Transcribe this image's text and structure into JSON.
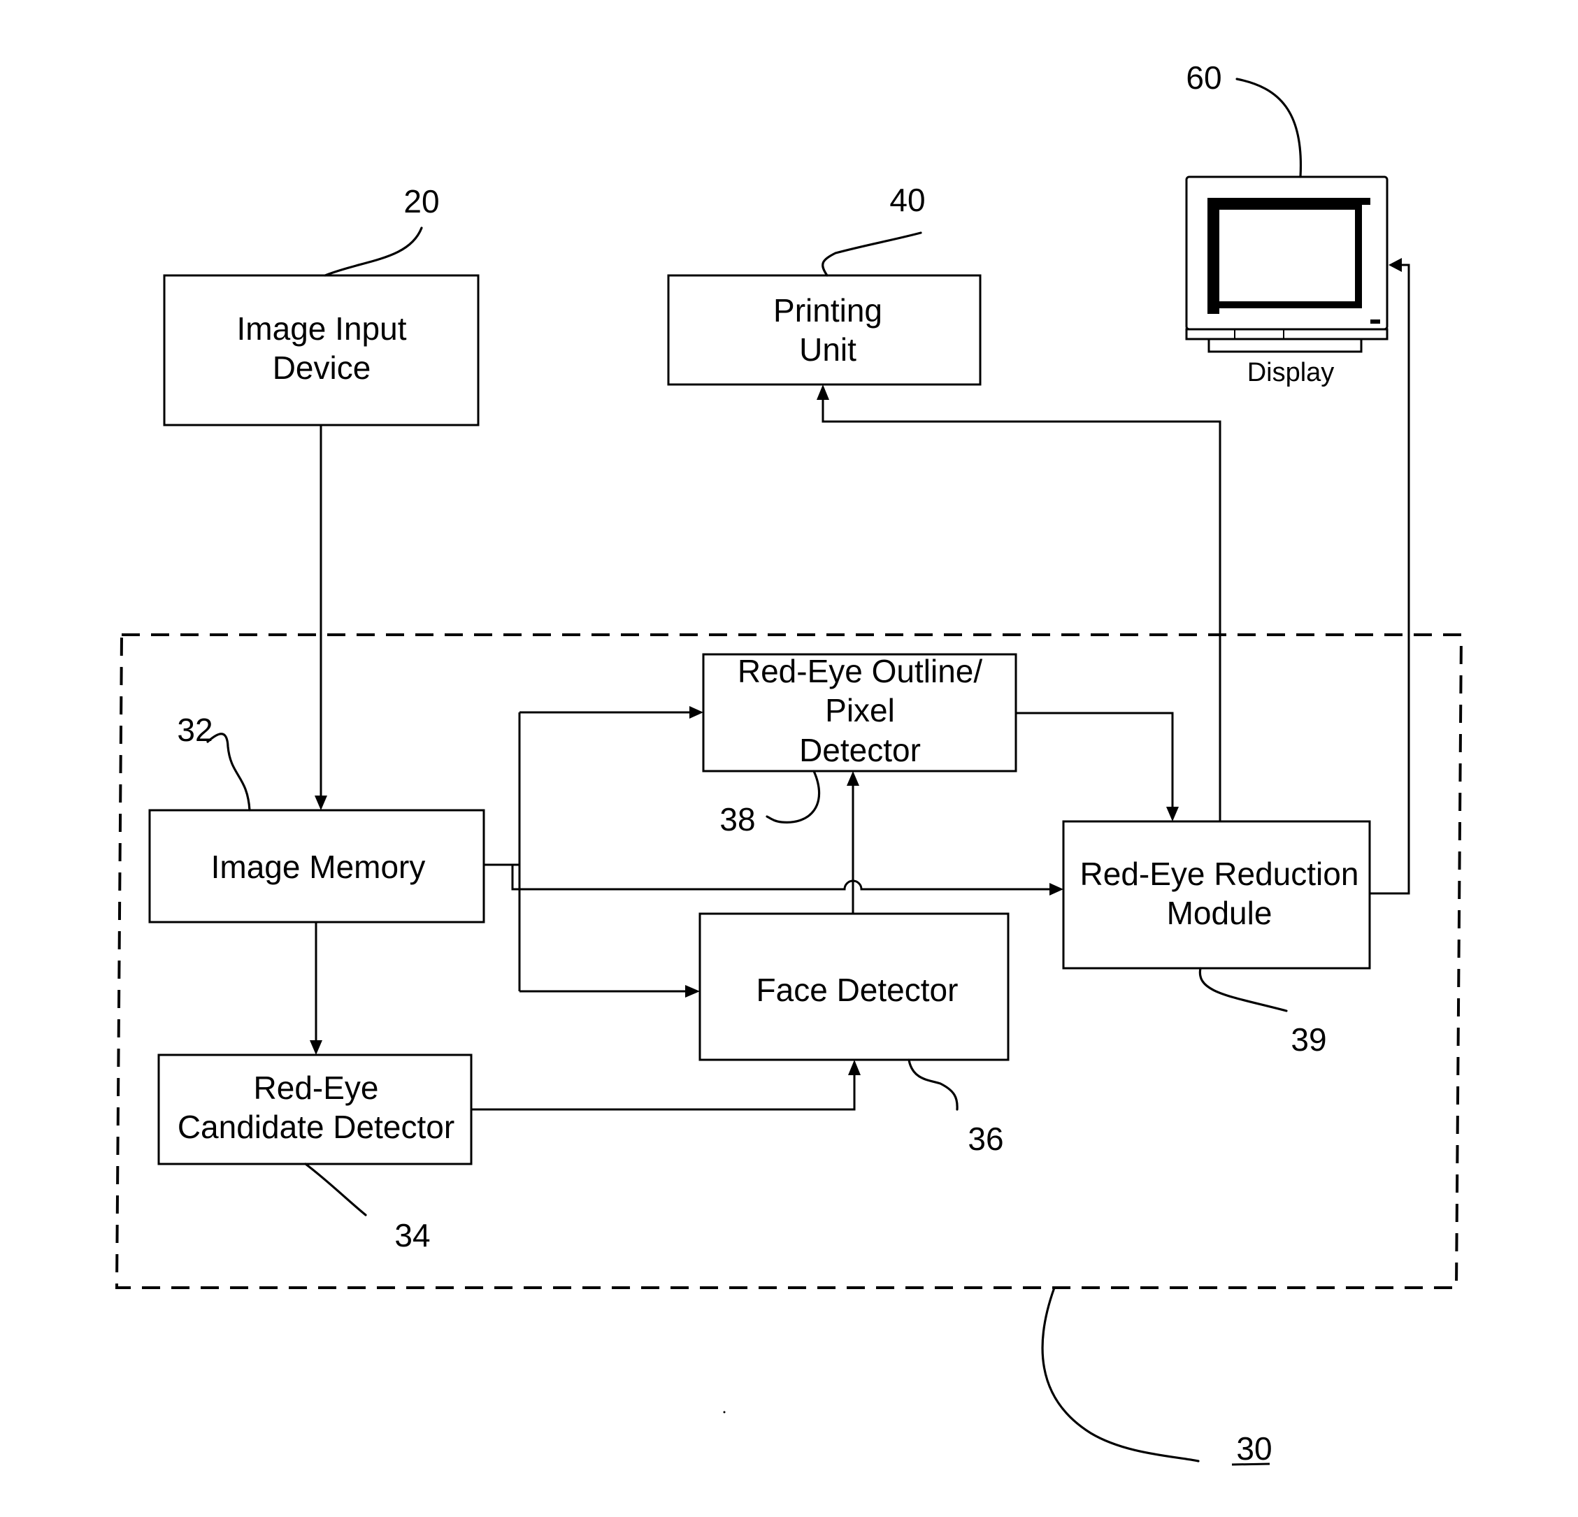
{
  "figure": {
    "system_ref": "30",
    "blocks": {
      "image_input": {
        "ref": "20",
        "lines": [
          "Image Input",
          "Device"
        ]
      },
      "printing_unit": {
        "ref": "40",
        "lines": [
          "Printing",
          "Unit"
        ]
      },
      "display": {
        "ref": "60",
        "label": "Display",
        "icon": "monitor-icon"
      },
      "image_memory": {
        "ref": "32",
        "lines": [
          "Image Memory"
        ]
      },
      "candidate_detector": {
        "ref": "34",
        "lines": [
          "Red-Eye",
          "Candidate Detector"
        ]
      },
      "face_detector": {
        "ref": "36",
        "lines": [
          "Face Detector"
        ]
      },
      "outline_detector": {
        "ref": "38",
        "lines": [
          "Red-Eye Outline/",
          "Pixel",
          "Detector"
        ]
      },
      "reduction_module": {
        "ref": "39",
        "lines": [
          "Red-Eye Reduction",
          "Module"
        ]
      }
    },
    "connections": [
      {
        "from": "image_input",
        "to": "image_memory"
      },
      {
        "from": "image_memory",
        "to": "outline_detector"
      },
      {
        "from": "image_memory",
        "to": "face_detector"
      },
      {
        "from": "image_memory",
        "to": "reduction_module"
      },
      {
        "from": "image_memory",
        "to": "candidate_detector"
      },
      {
        "from": "candidate_detector",
        "to": "face_detector"
      },
      {
        "from": "face_detector",
        "to": "outline_detector"
      },
      {
        "from": "outline_detector",
        "to": "reduction_module"
      },
      {
        "from": "reduction_module",
        "to": "printing_unit"
      },
      {
        "from": "reduction_module",
        "to": "display"
      }
    ]
  }
}
